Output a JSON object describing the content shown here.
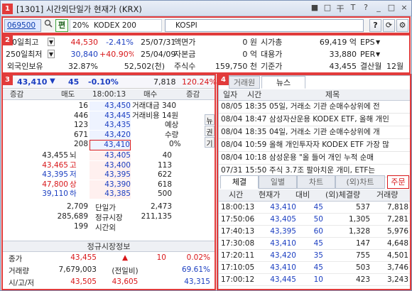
{
  "window": {
    "title": "[1301] 시간외단일가 현재가 (KRX)"
  },
  "titlebar_icons": [
    "■",
    "□",
    "干",
    "T",
    "?",
    "_",
    "□",
    "×"
  ],
  "toolbar": {
    "code": "069500",
    "pen_label": "편",
    "pct_label": "20%",
    "name": "KODEX 200",
    "index_name": "KOSPI"
  },
  "summary": {
    "rows": [
      {
        "label": "20일최고",
        "value": "44,530",
        "pct": "-2.41%",
        "date": "25/07/31",
        "k1": "액면가",
        "v1": "0 원",
        "k2": "시가총",
        "v2": "69,419 억",
        "k3": "EPS"
      },
      {
        "label": "250일최저",
        "value": "30,840",
        "pct": "+40.90%",
        "date": "25/04/09",
        "k1": "자본금",
        "v1": "0 억",
        "k2": "대용가",
        "v2": "33,880",
        "k3": "PER"
      },
      {
        "label": "외국인보유",
        "value": "32.87%",
        "pct": "",
        "date": "52,502(천)",
        "k1": "주식수",
        "v1": "159,750 천",
        "k2": "기준가",
        "v2": "43,455",
        "k3": "결산월",
        "v3": "12월"
      }
    ]
  },
  "quote": {
    "price": "43,410",
    "arrow": "▼",
    "change": "45",
    "rate": "-0.10%",
    "volume": "7,818",
    "vol_rate": "120.24%"
  },
  "orderbook": {
    "headers": [
      "증감",
      "매도",
      "18:00:13",
      "매수",
      "증감"
    ],
    "ask": [
      [
        "16",
        "43,450"
      ],
      [
        "446",
        "43,445"
      ],
      [
        "123",
        "43,435"
      ],
      [
        "671",
        "43,420"
      ],
      [
        "208",
        "43,410"
      ]
    ],
    "ask_info": [
      "거래대금 340",
      "거래비용 14원",
      "예상",
      "수량",
      "0%"
    ],
    "side_tabs": [
      "뉴",
      "권",
      "기"
    ],
    "bid": [
      [
        "43,455",
        "뇌",
        "43,405",
        "40"
      ],
      [
        "43,465",
        "고",
        "43,400",
        "113"
      ],
      [
        "43,395",
        "저",
        "43,395",
        "622"
      ],
      [
        "47,800",
        "상",
        "43,390",
        "618"
      ],
      [
        "39,110",
        "하",
        "43,385",
        "500"
      ]
    ],
    "totals": [
      [
        "2,709",
        "단일가",
        "2,473"
      ],
      [
        "285,689",
        "정규시장",
        "211,135"
      ],
      [
        "199",
        "시간외",
        ""
      ]
    ]
  },
  "regular": {
    "title": "정규시장정보",
    "rows": [
      [
        "종가",
        "43,455",
        "▲",
        "10",
        "0.02%"
      ],
      [
        "거래량",
        "7,679,003",
        "(전일비)",
        "",
        "69.61%"
      ],
      [
        "시/고/저",
        "43,505",
        "43,605",
        "",
        "43,315"
      ]
    ]
  },
  "news": {
    "tabs": [
      "거래원",
      "뉴스"
    ],
    "headers": [
      "일자",
      "시간",
      "제목"
    ],
    "items": [
      [
        "08/05",
        "18:35",
        "05일, 거래소 기관 순매수상위에 전"
      ],
      [
        "08/04",
        "18:47",
        "삼성자산운용 KODEX ETF, 올해 개인"
      ],
      [
        "08/04",
        "18:35",
        "04일, 거래소 기관 순매수상위에 개"
      ],
      [
        "08/04",
        "10:59",
        "올해 개인투자자 KODEX ETF 가장 많"
      ],
      [
        "08/04",
        "10:18",
        "삼성운용 \"올 들어 개인 누적 순매"
      ],
      [
        "07/31",
        "15:50",
        "주식 3.7조 팔아치운 개미, ETF는"
      ]
    ]
  },
  "trades": {
    "tabs": [
      "체결",
      "일별",
      "차트",
      "(외)차트",
      "주문"
    ],
    "headers": [
      "시간",
      "현재가",
      "대비",
      "(외)체결량",
      "거래량"
    ],
    "rows": [
      [
        "18:00:13",
        "43,410",
        "45",
        "537",
        "7,818"
      ],
      [
        "17:50:06",
        "43,405",
        "50",
        "1,305",
        "7,281"
      ],
      [
        "17:40:13",
        "43,395",
        "60",
        "1,328",
        "5,976"
      ],
      [
        "17:30:08",
        "43,410",
        "45",
        "147",
        "4,648"
      ],
      [
        "17:20:11",
        "43,420",
        "35",
        "755",
        "4,501"
      ],
      [
        "17:10:05",
        "43,410",
        "45",
        "503",
        "3,746"
      ],
      [
        "17:00:12",
        "43,445",
        "10",
        "423",
        "3,243"
      ]
    ]
  },
  "markers": [
    "1",
    "2",
    "3",
    "4"
  ]
}
